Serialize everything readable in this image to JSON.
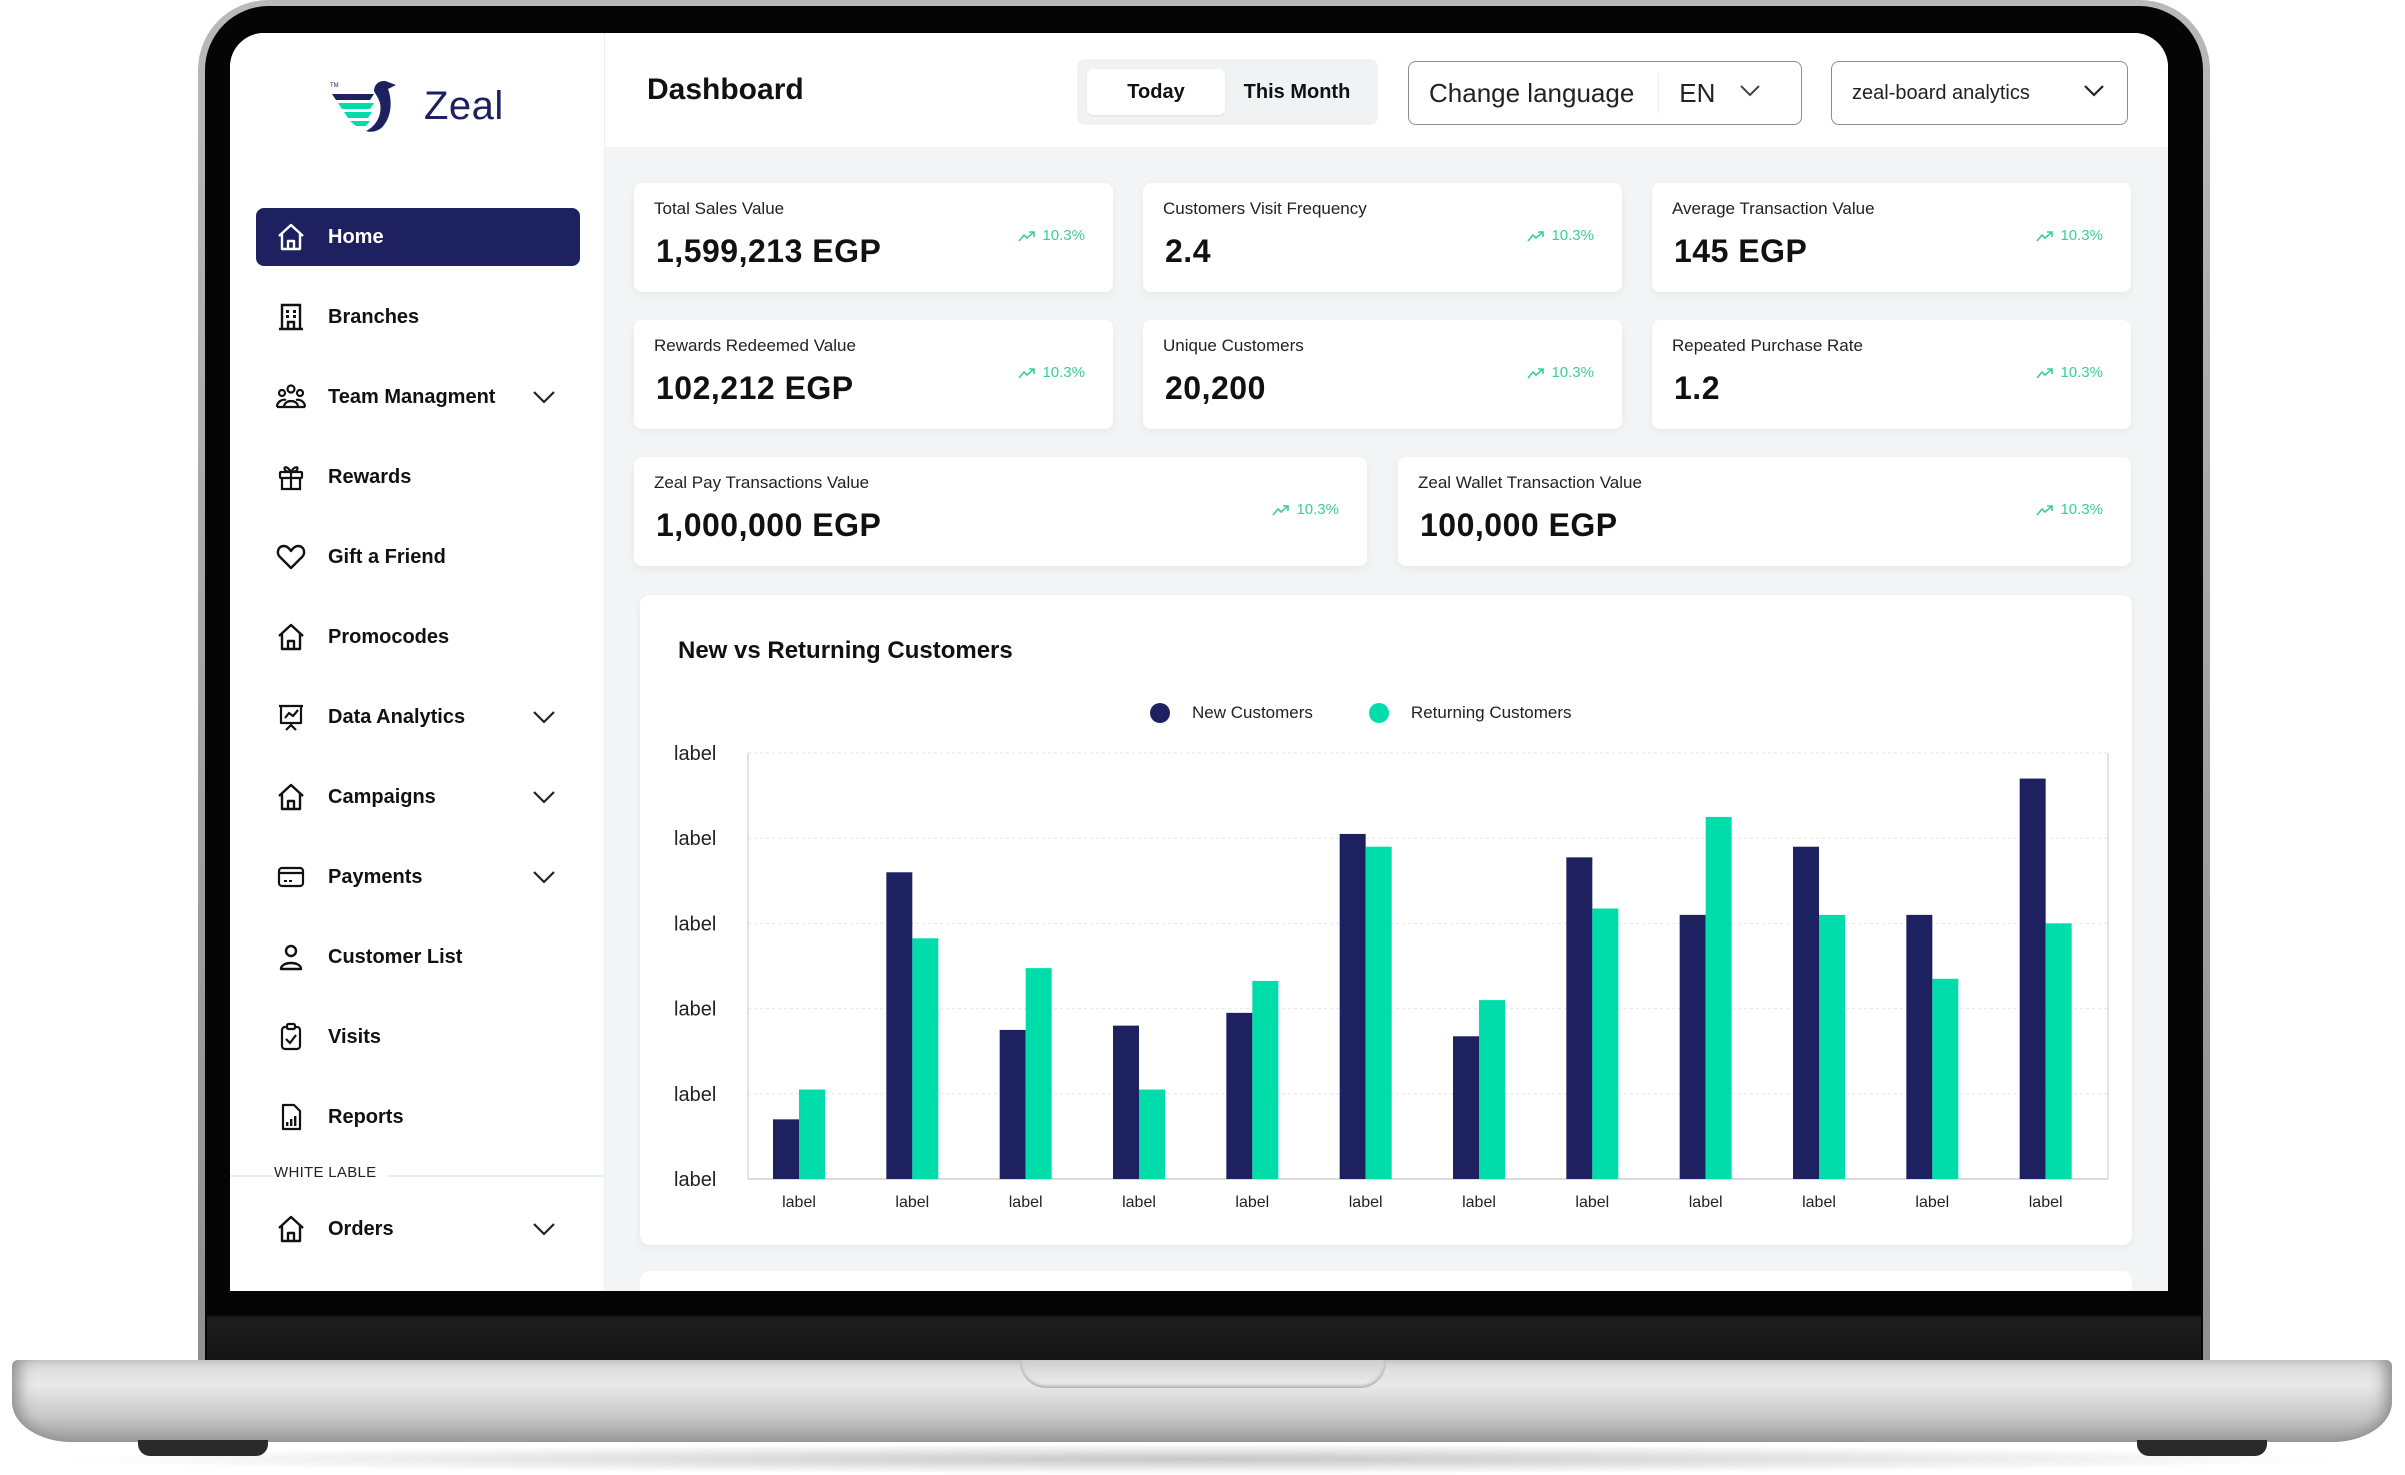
{
  "app": {
    "brand": "Zeal",
    "trademark": "TM"
  },
  "sidebar": {
    "items": [
      {
        "label": "Home",
        "icon": "home-icon",
        "active": true,
        "expandable": false
      },
      {
        "label": "Branches",
        "icon": "building-icon",
        "active": false,
        "expandable": false
      },
      {
        "label": "Team Managment",
        "icon": "team-icon",
        "active": false,
        "expandable": true
      },
      {
        "label": "Rewards",
        "icon": "gift-icon",
        "active": false,
        "expandable": false
      },
      {
        "label": "Gift a Friend",
        "icon": "heart-icon",
        "active": false,
        "expandable": false
      },
      {
        "label": "Promocodes",
        "icon": "home-icon",
        "active": false,
        "expandable": false
      },
      {
        "label": "Data Analytics",
        "icon": "presentation-chart-icon",
        "active": false,
        "expandable": true
      },
      {
        "label": "Campaigns",
        "icon": "home-icon",
        "active": false,
        "expandable": true
      },
      {
        "label": "Payments",
        "icon": "credit-card-icon",
        "active": false,
        "expandable": true
      },
      {
        "label": "Customer List",
        "icon": "user-icon",
        "active": false,
        "expandable": false
      },
      {
        "label": "Visits",
        "icon": "clipboard-check-icon",
        "active": false,
        "expandable": false
      },
      {
        "label": "Reports",
        "icon": "report-file-icon",
        "active": false,
        "expandable": false
      }
    ],
    "section_label": "WHITE LABLE",
    "section_items": [
      {
        "label": "Orders",
        "icon": "home-icon",
        "active": false,
        "expandable": true
      }
    ]
  },
  "header": {
    "title": "Dashboard",
    "period_options": [
      "Today",
      "This Month"
    ],
    "period_selected": "Today",
    "language_label": "Change language",
    "language_value": "EN",
    "account_value": "zeal-board analytics"
  },
  "kpis": [
    {
      "title": "Total Sales Value",
      "value": "1,599,213 EGP",
      "trend": "10.3%",
      "trend_direction": "up"
    },
    {
      "title": "Customers Visit Frequency",
      "value": "2.4",
      "trend": "10.3%",
      "trend_direction": "up"
    },
    {
      "title": "Average Transaction Value",
      "value": "145 EGP",
      "trend": "10.3%",
      "trend_direction": "up"
    },
    {
      "title": "Rewards Redeemed Value",
      "value": "102,212 EGP",
      "trend": "10.3%",
      "trend_direction": "up"
    },
    {
      "title": "Unique Customers",
      "value": "20,200",
      "trend": "10.3%",
      "trend_direction": "up"
    },
    {
      "title": "Repeated Purchase Rate",
      "value": "1.2",
      "trend": "10.3%",
      "trend_direction": "up"
    },
    {
      "title": "Zeal Pay Transactions Value",
      "value": "1,000,000 EGP",
      "trend": "10.3%",
      "trend_direction": "up"
    },
    {
      "title": "Zeal Wallet Transaction Value",
      "value": "100,000 EGP",
      "trend": "10.3%",
      "trend_direction": "up"
    }
  ],
  "colors": {
    "brand_navy": "#1d2160",
    "brand_green": "#00ddaa",
    "trend_green": "#3ad08f"
  },
  "chart_data": {
    "type": "bar",
    "title": "New vs Returning Customers",
    "xlabel": "",
    "ylabel": "",
    "legend_position": "top-center",
    "grid": true,
    "categories": [
      "label",
      "label",
      "label",
      "label",
      "label",
      "label",
      "label",
      "label",
      "label",
      "label",
      "label",
      "label"
    ],
    "y_tick_labels": [
      "label",
      "label",
      "label",
      "label",
      "label",
      "label"
    ],
    "ylim": [
      0,
      100
    ],
    "series": [
      {
        "name": "New Customers",
        "color": "#1d2160",
        "values": [
          14,
          72,
          35,
          36,
          39,
          81,
          33.5,
          75.5,
          62,
          78,
          62,
          94
        ]
      },
      {
        "name": "Returning Customers",
        "color": "#00ddaa",
        "values": [
          21,
          56.5,
          49.5,
          21,
          46.5,
          78,
          42,
          63.5,
          85,
          62,
          47,
          60
        ]
      }
    ]
  }
}
